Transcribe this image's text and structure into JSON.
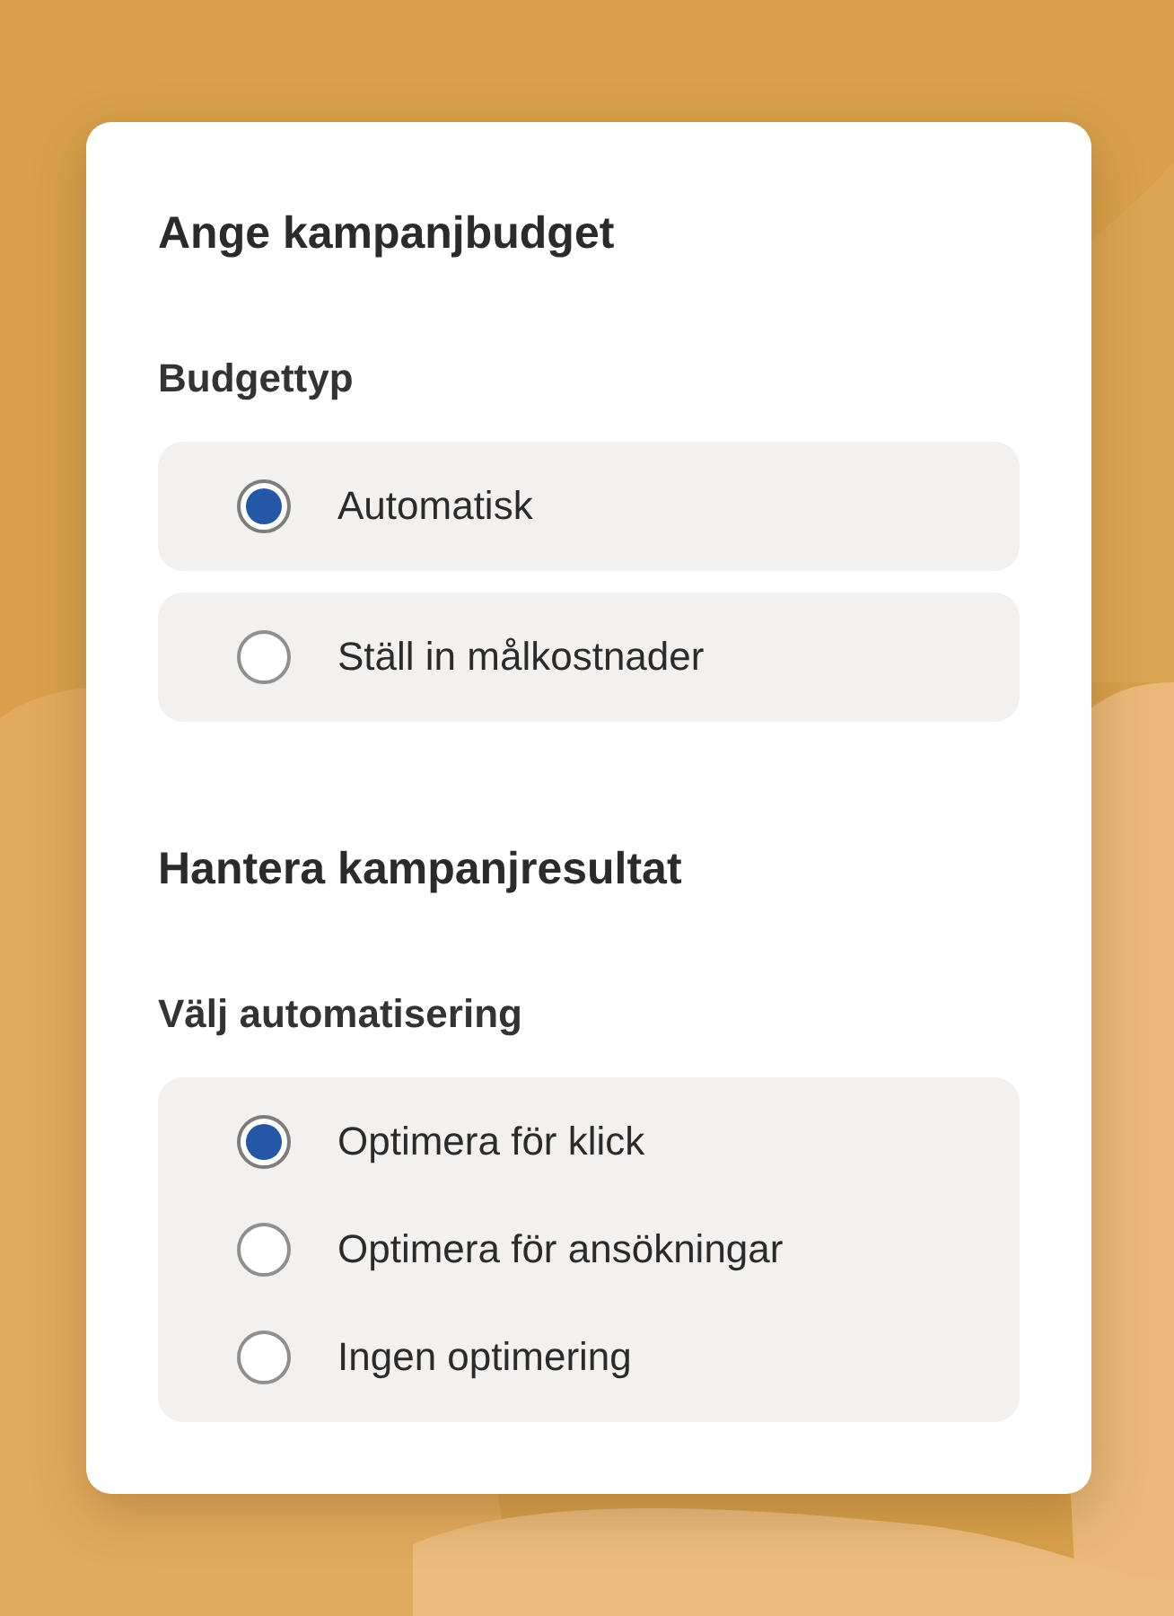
{
  "sections": [
    {
      "title": "Ange kampanjbudget",
      "subtitle": "Budgettyp",
      "kind": "cards",
      "options": [
        {
          "label": "Automatisk",
          "selected": true
        },
        {
          "label": "Ställ in målkostnader",
          "selected": false
        }
      ]
    },
    {
      "title": "Hantera kampanjresultat",
      "subtitle": "Välj automatisering",
      "kind": "panel",
      "options": [
        {
          "label": "Optimera för klick",
          "selected": true
        },
        {
          "label": "Optimera för ansökningar",
          "selected": false
        },
        {
          "label": "Ingen optimering",
          "selected": false
        }
      ]
    }
  ]
}
